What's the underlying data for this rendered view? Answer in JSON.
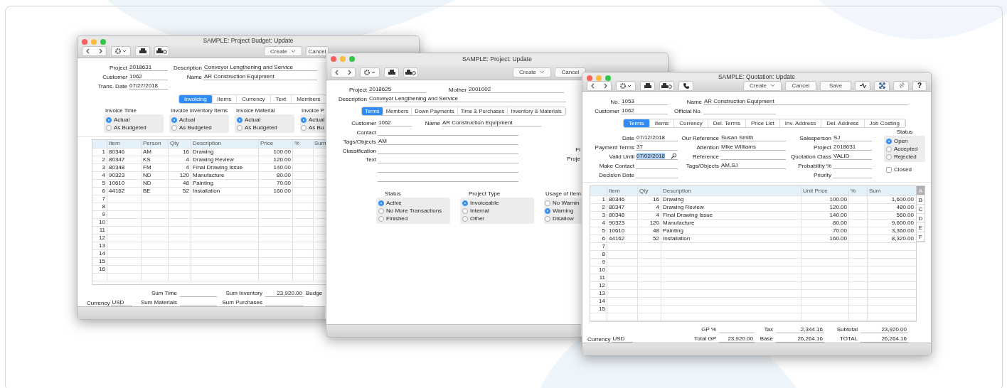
{
  "budget": {
    "title": "SAMPLE: Project Budget: Update",
    "buttons": [
      "Create",
      "Cancel"
    ],
    "field_rows": [
      [
        {
          "label": "Project",
          "value": "2018631"
        },
        {
          "label": "Description",
          "value": "Conveyor Lengthening and Service"
        }
      ],
      [
        {
          "label": "Customer",
          "value": "1062"
        },
        {
          "label": "Name",
          "value": "AR Construction Equipment"
        }
      ],
      [
        {
          "label": "Trans. Date",
          "value": "07/27/2018"
        }
      ]
    ],
    "tabs": [
      {
        "label": "Invoicing",
        "selected": true
      },
      {
        "label": "Items",
        "selected": false
      },
      {
        "label": "Currency",
        "selected": false
      },
      {
        "label": "Text",
        "selected": false
      },
      {
        "label": "Members",
        "selected": false
      }
    ],
    "radio_groups": [
      {
        "title": "Invoice Time",
        "options": [
          {
            "label": "Actual",
            "selected": true
          },
          {
            "label": "As Budgeted",
            "selected": false
          }
        ]
      },
      {
        "title": "Invoice Inventory Items",
        "options": [
          {
            "label": "Actual",
            "selected": true
          },
          {
            "label": "As Budgeted",
            "selected": false
          }
        ]
      },
      {
        "title": "Invoice Material",
        "options": [
          {
            "label": "Actual",
            "selected": true
          },
          {
            "label": "As Budgeted",
            "selected": false
          }
        ]
      },
      {
        "title": "Invoice P",
        "options": [
          {
            "label": "Actual",
            "selected": true
          },
          {
            "label": "As Bu",
            "selected": false
          }
        ]
      }
    ],
    "table": {
      "columns": [
        "",
        "Item",
        "Person",
        "Qty",
        "Description",
        "Price",
        "%",
        "Sum"
      ],
      "rows": [
        [
          "1",
          "80346",
          "AM",
          "16",
          "Drawing",
          "100.00"
        ],
        [
          "2",
          "80347",
          "KS",
          "4",
          "Drawing Review",
          "120.00"
        ],
        [
          "3",
          "80348",
          "FM",
          "4",
          "Final Drawing Issue",
          "140.00"
        ],
        [
          "4",
          "90323",
          "ND",
          "120",
          "Manufacture",
          "80.00"
        ],
        [
          "5",
          "10610",
          "ND",
          "48",
          "Painting",
          "70.00"
        ],
        [
          "6",
          "44162",
          "BE",
          "52",
          "Installation",
          "160.00"
        ],
        [
          "7"
        ],
        [
          "8"
        ],
        [
          "9"
        ],
        [
          "10"
        ],
        [
          "11"
        ],
        [
          "12"
        ],
        [
          "13"
        ],
        [
          "14"
        ],
        [
          "15"
        ],
        [
          "16"
        ]
      ]
    },
    "currency": {
      "label": "Currency",
      "value": "USD"
    },
    "sums": [
      {
        "label": "Sum Time"
      },
      {
        "label": "Sum Inventory",
        "value": "23,920.00"
      },
      {
        "label": "Sum Materials"
      },
      {
        "label": "Sum Purchases"
      }
    ],
    "cut_label": "Budge"
  },
  "project": {
    "title": "SAMPLE: Project: Update",
    "buttons": [
      "Create",
      "Cancel"
    ],
    "field_rows": [
      [
        {
          "label": "Project",
          "value": "2018625"
        },
        {
          "label": "Mother",
          "value": "2001002"
        }
      ],
      [
        {
          "label": "Description",
          "value": "Conveyor Lengthening and Service"
        }
      ]
    ],
    "tabs": [
      {
        "label": "Terms",
        "selected": true
      },
      {
        "label": "Members",
        "selected": false
      },
      {
        "label": "Down Payments",
        "selected": false
      },
      {
        "label": "Time & Purchases",
        "selected": false
      },
      {
        "label": "Inventory & Materials",
        "selected": false
      }
    ],
    "detail_rows": [
      [
        {
          "label": "Customer",
          "value": "1062"
        },
        {
          "label": "Name",
          "value": "AR Construction Equipment"
        }
      ],
      [
        {
          "label": "Contact"
        }
      ],
      [
        {
          "label": "Tags/Objects",
          "value": "AM"
        }
      ],
      [
        {
          "label": "Classification"
        }
      ]
    ],
    "text_area": {
      "label": "Text"
    },
    "cut_labels": [
      "Fi",
      "Proje"
    ],
    "radio_groups": [
      {
        "title": "Status",
        "options": [
          {
            "label": "Active",
            "selected": true
          },
          {
            "label": "No More Transactions",
            "selected": false
          },
          {
            "label": "Finished",
            "selected": false
          }
        ]
      },
      {
        "title": "Project Type",
        "options": [
          {
            "label": "Invoiceable",
            "selected": true
          },
          {
            "label": "Internal",
            "selected": false
          },
          {
            "label": "Other",
            "selected": false
          }
        ]
      },
      {
        "title": "Usage of Item",
        "options": [
          {
            "label": "No Warnin",
            "selected": false
          },
          {
            "label": "Warning",
            "selected": true
          },
          {
            "label": "Disallow",
            "selected": false
          }
        ]
      }
    ]
  },
  "quotation": {
    "title": "SAMPLE: Quotation: Update",
    "buttons": [
      "Create",
      "Cancel",
      "Save"
    ],
    "help": "?",
    "field_rows": [
      [
        {
          "label": "No.",
          "value": "1053"
        },
        {
          "label": "Name",
          "value": "AR Construction Equipment"
        }
      ],
      [
        {
          "label": "Customer",
          "value": "1062"
        },
        {
          "label": "Official No."
        }
      ]
    ],
    "tabs": [
      {
        "label": "Terms",
        "selected": true
      },
      {
        "label": "Items",
        "selected": false
      },
      {
        "label": "Currency",
        "selected": false
      },
      {
        "label": "Del. Terms",
        "selected": false
      },
      {
        "label": "Price List",
        "selected": false
      },
      {
        "label": "Inv. Address",
        "selected": false
      },
      {
        "label": "Del. Address",
        "selected": false
      },
      {
        "label": "Job Costing",
        "selected": false
      }
    ],
    "field_columns": [
      [
        {
          "kind": "text",
          "highlighted": false,
          "label": "Date",
          "value": "07/12/2018"
        },
        {
          "kind": "text",
          "highlighted": false,
          "label": "Payment Terms",
          "value": "37"
        },
        {
          "kind": "lookup",
          "highlighted": true,
          "label": "Valid Until",
          "value": "07/02/2018"
        },
        {
          "kind": "text",
          "label": "Make Contact"
        },
        {
          "kind": "text",
          "label": "Decision Date"
        }
      ],
      [
        {
          "label": "Our Reference",
          "value": "Susan Smith"
        },
        {
          "label": "Attention",
          "value": "Mike Williams"
        },
        {
          "label": "Reference"
        },
        {
          "label": "Tags/Objects",
          "value": "AM,SJ"
        }
      ],
      [
        {
          "label": "Salesperson",
          "value": "SJ"
        },
        {
          "label": "Project",
          "value": "2018631"
        },
        {
          "label": "Quotation Class",
          "value": "VALID"
        },
        {
          "label": "Probability %"
        },
        {
          "label": "Priority"
        }
      ]
    ],
    "status": {
      "title": "Status",
      "options": [
        {
          "label": "Open",
          "selected": true
        },
        {
          "label": "Accepted",
          "selected": false
        },
        {
          "label": "Rejected",
          "selected": false
        }
      ]
    },
    "closed": {
      "label": "Closed",
      "checked": false
    },
    "table": {
      "columns": [
        "",
        "Item",
        "Qty",
        "Description",
        "Unit Price",
        "%",
        "Sum"
      ],
      "rows": [
        [
          "1",
          "80346",
          "16",
          "Drawing",
          "100.00",
          "",
          "1,600.00"
        ],
        [
          "2",
          "80347",
          "4",
          "Drawing Review",
          "120.00",
          "",
          "480.00"
        ],
        [
          "3",
          "80348",
          "4",
          "Final Drawing Issue",
          "140.00",
          "",
          "560.00"
        ],
        [
          "4",
          "90323",
          "120",
          "Manufacture",
          "80.00",
          "",
          "9,600.00"
        ],
        [
          "5",
          "10610",
          "48",
          "Painting",
          "70.00",
          "",
          "3,360.00"
        ],
        [
          "6",
          "44162",
          "52",
          "Installation",
          "160.00",
          "",
          "8,320.00"
        ],
        [
          "7"
        ],
        [
          "8"
        ],
        [
          "9"
        ],
        [
          "10"
        ],
        [
          "11"
        ],
        [
          "12"
        ],
        [
          "13"
        ],
        [
          "14"
        ],
        [
          "15"
        ]
      ]
    },
    "side_tabs": [
      {
        "label": "A",
        "selected": true
      },
      {
        "label": "B",
        "selected": false
      },
      {
        "label": "C",
        "selected": false
      },
      {
        "label": "D",
        "selected": false
      },
      {
        "label": "E",
        "selected": false
      },
      {
        "label": "F",
        "selected": false
      }
    ],
    "currency": {
      "label": "Currency",
      "value": "USD"
    },
    "totals": [
      {
        "label": "GP %"
      },
      {
        "label": "Tax",
        "value": "2,344.16"
      },
      {
        "label": "Subtotal",
        "value": "23,920.00"
      },
      {
        "label": "Total GP",
        "value": "23,920.00"
      },
      {
        "label": "Base",
        "value": "26,264.16"
      },
      {
        "label": "TOTAL",
        "value": "26,264.16"
      }
    ]
  }
}
